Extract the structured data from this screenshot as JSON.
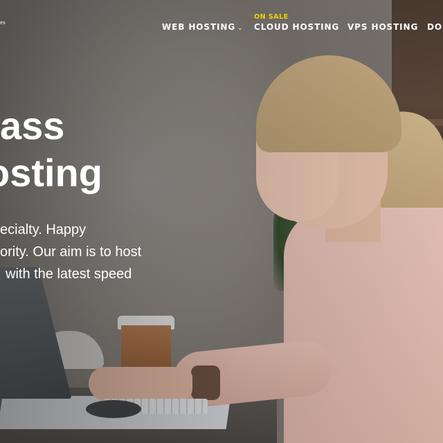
{
  "brand": {
    "logo_text": "es"
  },
  "nav": {
    "items": [
      {
        "label": "WEB HOSTING",
        "has_dropdown": true
      },
      {
        "label": "CLOUD HOSTING",
        "badge": "ON SALE"
      },
      {
        "label": "VPS HOSTING"
      },
      {
        "label": "DOM"
      }
    ],
    "badge_color": "#f4d000"
  },
  "hero": {
    "title_lines": [
      "ass",
      "osting"
    ],
    "description_lines": [
      "ecialty. Happy",
      "ority. Our aim is to host",
      "with the latest speed"
    ]
  }
}
